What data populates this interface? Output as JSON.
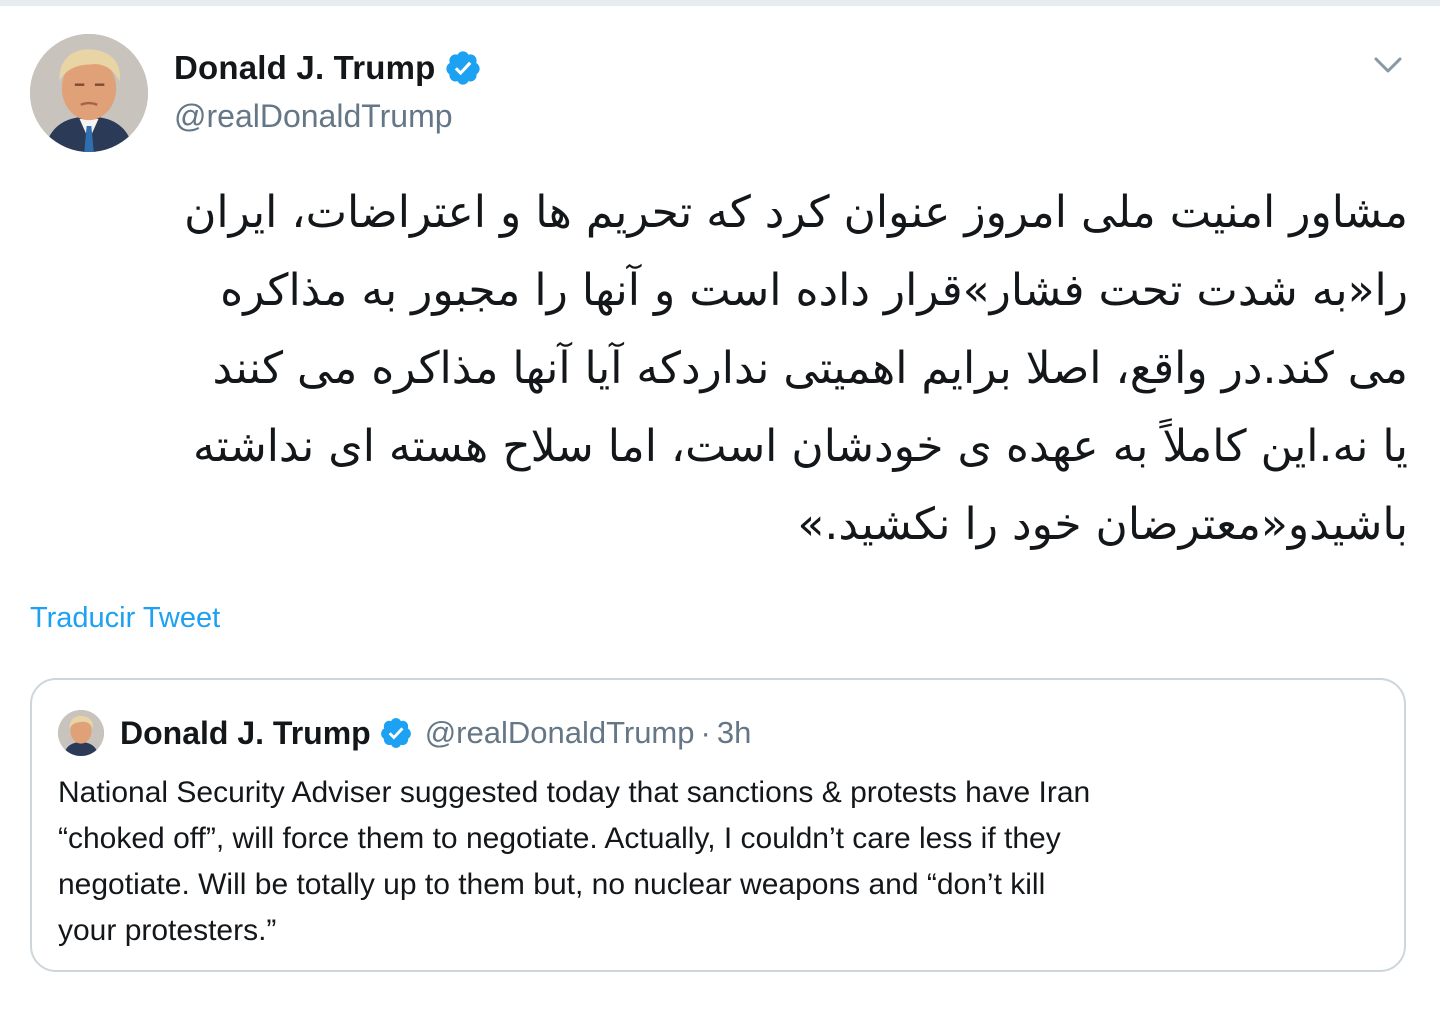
{
  "tweet": {
    "author": {
      "display_name": "Donald J. Trump",
      "handle": "@realDonaldTrump",
      "verified": true
    },
    "body_lines": [
      "مشاور امنیت ملی امروز عنوان کرد که تحریم ها و اعتراضات، ایران",
      "را«به شدت تحت فشار»قرار داده است و آنها را مجبور به مذاکره",
      "می کند.در واقع، اصلا برایم اهمیتی نداردکه آیا آنها مذاکره می کنند",
      "یا نه.این کاملاً به عهده ی خودشان است، اما سلاح هسته ای نداشته",
      "باشیدو«معترضان خود را نکشید.»"
    ],
    "translate_link": "Traducir Tweet",
    "icons": {
      "verified": "verified-badge-icon",
      "menu": "chevron-down-icon"
    },
    "colors": {
      "link": "#1da1f2",
      "secondary": "#657786",
      "border": "#ccd6dd"
    }
  },
  "quoted_tweet": {
    "author": {
      "display_name": "Donald J. Trump",
      "handle": "@realDonaldTrump",
      "verified": true
    },
    "separator": "·",
    "time": "3h",
    "body_lines": [
      "National Security Adviser suggested today that sanctions & protests have Iran",
      "“choked off”, will force them to negotiate. Actually, I couldn’t care less if they",
      "negotiate. Will be totally up to them but, no nuclear weapons and “don’t kill",
      "your protesters.”"
    ]
  }
}
